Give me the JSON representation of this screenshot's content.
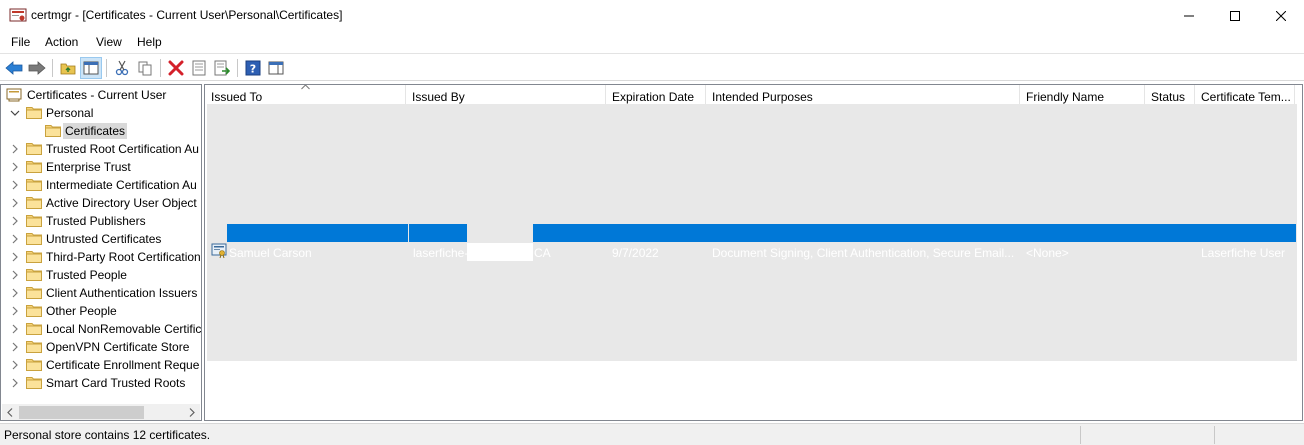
{
  "window": {
    "title": "certmgr - [Certificates - Current User\\Personal\\Certificates]"
  },
  "menu": [
    "File",
    "Action",
    "View",
    "Help"
  ],
  "toolbar": {
    "buttons": [
      "back-arrow",
      "forward-arrow",
      "up-folder",
      "show-hide-console-tree",
      "cut",
      "copy",
      "delete",
      "properties",
      "export-list",
      "help",
      "show-pane"
    ]
  },
  "tree": {
    "root": "Certificates - Current User",
    "items": [
      {
        "label": "Personal",
        "expanded": true
      },
      {
        "label": "Certificates",
        "selected": true
      },
      {
        "label": "Trusted Root Certification Au"
      },
      {
        "label": "Enterprise Trust"
      },
      {
        "label": "Intermediate Certification Au"
      },
      {
        "label": "Active Directory User Object"
      },
      {
        "label": "Trusted Publishers"
      },
      {
        "label": "Untrusted Certificates"
      },
      {
        "label": "Third-Party Root Certification"
      },
      {
        "label": "Trusted People"
      },
      {
        "label": "Client Authentication Issuers"
      },
      {
        "label": "Other People"
      },
      {
        "label": "Local NonRemovable Certific"
      },
      {
        "label": "OpenVPN Certificate Store"
      },
      {
        "label": "Certificate Enrollment Reque"
      },
      {
        "label": "Smart Card Trusted Roots"
      }
    ]
  },
  "list": {
    "columns": [
      "Issued To",
      "Issued By",
      "Expiration Date",
      "Intended Purposes",
      "Friendly Name",
      "Status",
      "Certificate Tem..."
    ],
    "row": {
      "issued_to": "Samuel Carson",
      "issued_by": "laserfiche-",
      "issued_by_suffix": "CA",
      "expiration": "9/7/2022",
      "purposes": "Document Signing, Client Authentication, Secure Email...",
      "friendly_name": "<None>",
      "status": "",
      "template": "Laserfiche User"
    }
  },
  "status": {
    "text": "Personal store contains 12 certificates."
  },
  "colors": {
    "selection": "#0078d7",
    "list_background": "#e8e8e8"
  }
}
